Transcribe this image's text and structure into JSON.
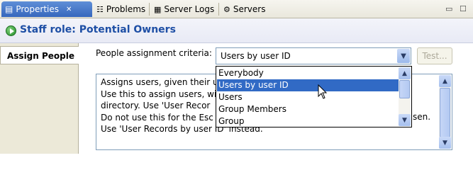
{
  "tabs": [
    {
      "label": "Properties",
      "close": "✕",
      "icon": "properties-icon"
    },
    {
      "label": "Problems",
      "icon": "problems-icon"
    },
    {
      "label": "Server Logs",
      "icon": "server-logs-icon"
    },
    {
      "label": "Servers",
      "icon": "servers-icon"
    }
  ],
  "window_controls": {
    "minimize": "▭",
    "maximize": "☐"
  },
  "header": {
    "title": "Staff role: Potential Owners"
  },
  "sidebar": {
    "tab": "Assign People"
  },
  "criteria": {
    "label": "People assignment criteria:",
    "selected": "Users by user ID",
    "options": [
      "Everybody",
      "Users by user ID",
      "Users",
      "Group Members",
      "Group"
    ],
    "test_button": "Test..."
  },
  "description": {
    "lines": [
      "Assigns users, given their u",
      "Use this to assign users, wi",
      "directory. Use 'User Recor",
      "Do not use this for the Esc",
      "Use 'User Records by user ID' instead."
    ],
    "tail_line4": "sen.",
    "tail_line5": "",
    "tail_line3_right": "",
    "right_fragment_line4": "sen."
  },
  "colors": {
    "accent": "#316ac5",
    "title": "#1e4fa5",
    "active_tab": "#3667bd"
  }
}
